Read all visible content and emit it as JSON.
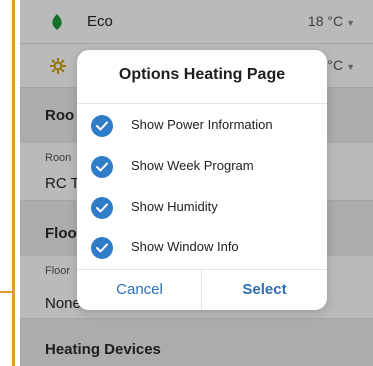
{
  "modes": [
    {
      "name": "Eco",
      "temp": "18 °C",
      "icon": "leaf-icon"
    },
    {
      "name": "",
      "temp": "°C",
      "icon": "sun-icon"
    }
  ],
  "sections": {
    "rooms": {
      "title": "Roo",
      "label": "Roon",
      "value": "RC T"
    },
    "floor": {
      "title": "Floo",
      "label": "Floor",
      "value": "None"
    },
    "heating": {
      "title": "Heating Devices"
    }
  },
  "dialog": {
    "title": "Options Heating Page",
    "options": [
      {
        "label": "Show Power Information",
        "checked": true
      },
      {
        "label": "Show Week Program",
        "checked": true
      },
      {
        "label": "Show Humidity",
        "checked": true
      },
      {
        "label": "Show Window Info",
        "checked": true
      }
    ],
    "cancel_label": "Cancel",
    "select_label": "Select"
  },
  "colors": {
    "accent": "#2f7cc8",
    "leaf": "#1e9c3a",
    "sun": "#c8a000",
    "connector": "#e69a2e"
  }
}
